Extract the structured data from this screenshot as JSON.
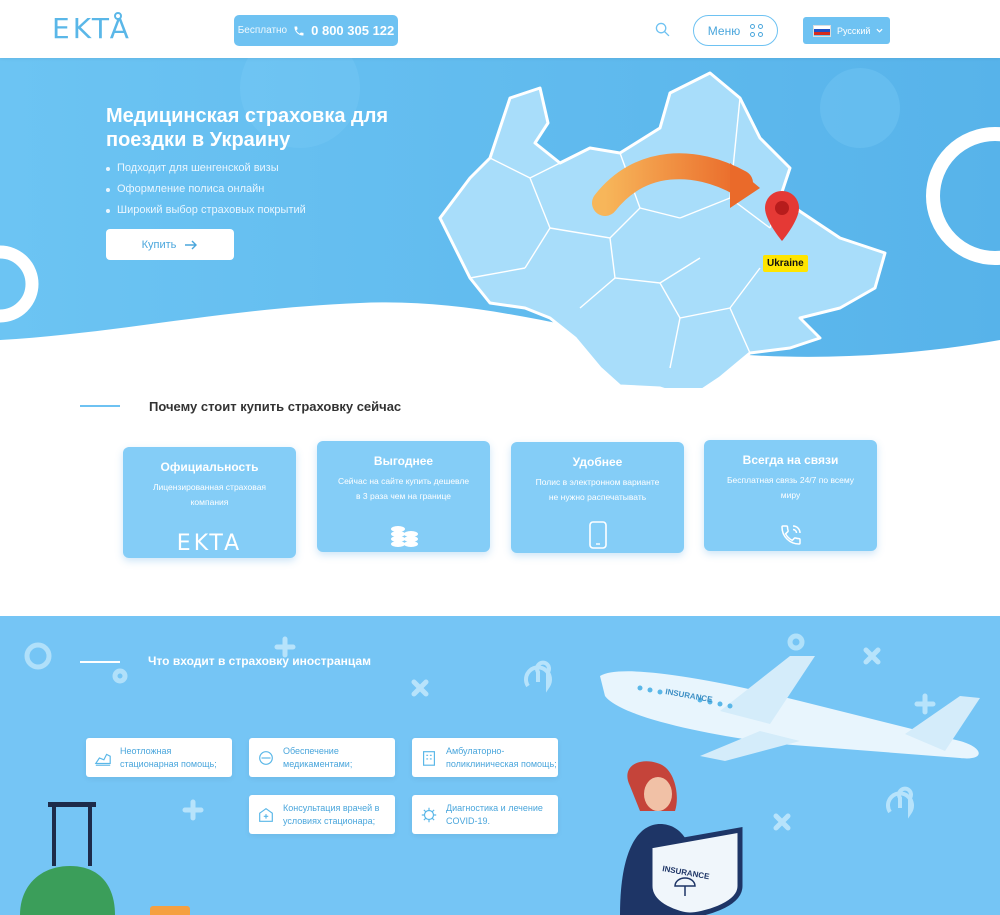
{
  "header": {
    "logo": "EKTA",
    "phone_free_label": "Бесплатно",
    "phone_number": "0 800 305 122",
    "menu_label": "Меню",
    "language": "Русский"
  },
  "hero": {
    "title": "Медицинская страховка для поездки в Украину",
    "bullets": [
      "Подходит для шенгенской визы",
      "Оформление полиса онлайн",
      "Широкий выбор страховых покрытий"
    ],
    "buy_label": "Купить",
    "map_label": "Ukraine"
  },
  "why": {
    "title": "Почему стоит купить страховку сейчас",
    "cards": [
      {
        "title": "Официальность",
        "desc": "Лицензированная страховая компания",
        "icon": "ekta-logo-icon",
        "logo_text": "EKTA"
      },
      {
        "title": "Выгоднее",
        "desc": "Сейчас на сайте купить дешевле в 3 раза чем на границе",
        "icon": "coins-icon"
      },
      {
        "title": "Удобнее",
        "desc": "Полис в электронном варианте не нужно распечатывать",
        "icon": "smartphone-icon"
      },
      {
        "title": "Всегда на связи",
        "desc": "Бесплатная связь 24/7 по всему миру",
        "icon": "phone-call-icon"
      }
    ]
  },
  "coverage": {
    "title": "Что входит в страховку иностранцам",
    "items": [
      {
        "label": "Неотложная стационарная помощь;",
        "icon": "hospital-bed-icon"
      },
      {
        "label": "Обеспечение медикаментами;",
        "icon": "pill-icon"
      },
      {
        "label": "Амбулаторно-поликлиническая помощь;",
        "icon": "clinic-building-icon"
      },
      {
        "label": "Консультация врачей в условиях стационара;",
        "icon": "doctor-consultation-icon"
      },
      {
        "label": "Диагностика и лечение COVID-19.",
        "icon": "virus-icon"
      }
    ],
    "shield_text": "INSURANCE"
  },
  "colors": {
    "primary": "#6ec2f2",
    "hero_bg": "#62bdf0",
    "card_bg": "#84cdf7",
    "accent_orange": "#f08a3c",
    "pin_red": "#e53935",
    "label_yellow": "#ffe500"
  }
}
